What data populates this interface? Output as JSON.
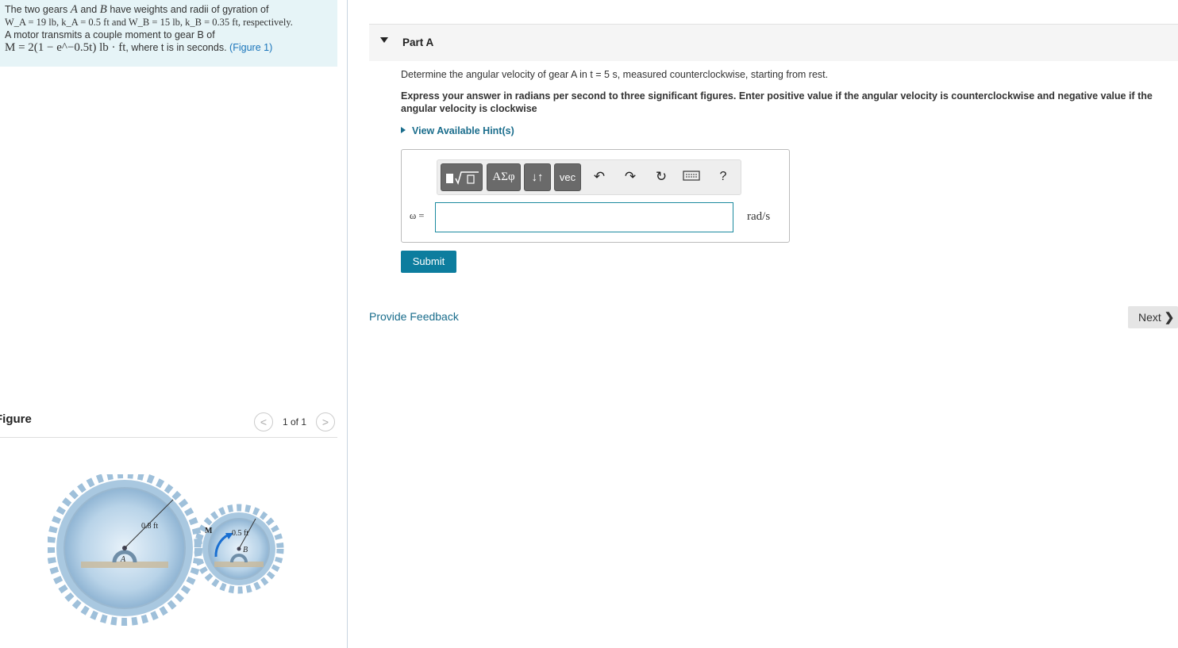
{
  "problem": {
    "line1_pre": "The two gears ",
    "var_A": "A",
    "line1_and": " and ",
    "var_B": "B",
    "line1_post": " have weights and radii of gyration of",
    "line2": "W_A = 19 lb, k_A = 0.5 ft and W_B = 15 lb, k_B = 0.35 ft, respectively.",
    "line3": "A motor transmits a couple moment to gear B of",
    "line4_math": "M = 2(1 − e^−0.5t) lb · ft",
    "line4_post": ", where t is in seconds.",
    "figure_link": "(Figure 1)"
  },
  "figure": {
    "title": "Figure",
    "counter": "1 of 1",
    "prev_glyph": "<",
    "next_glyph": ">",
    "gear_a_radius_label": "0.8 ft",
    "gear_b_radius_label": "0.5 ft",
    "moment_label": "M",
    "gear_a_label": "A",
    "gear_b_label": "B"
  },
  "part": {
    "title": "Part A",
    "question": "Determine the angular velocity of gear A in t = 5 s, measured counterclockwise, starting from rest.",
    "instruction": "Express your answer in radians per second to three significant figures. Enter positive value if the angular velocity is counterclockwise and negative value if the angular velocity is clockwise",
    "hint_link": "View Available Hint(s)"
  },
  "toolbar": {
    "greek_label": "ΑΣφ",
    "arrows_label": "↓↑",
    "vec_label": "vec",
    "help_label": "?"
  },
  "answer": {
    "variable_label": "ω =",
    "value": "",
    "unit": "rad/s"
  },
  "actions": {
    "submit_label": "Submit",
    "feedback_label": "Provide Feedback",
    "next_label": "Next"
  }
}
